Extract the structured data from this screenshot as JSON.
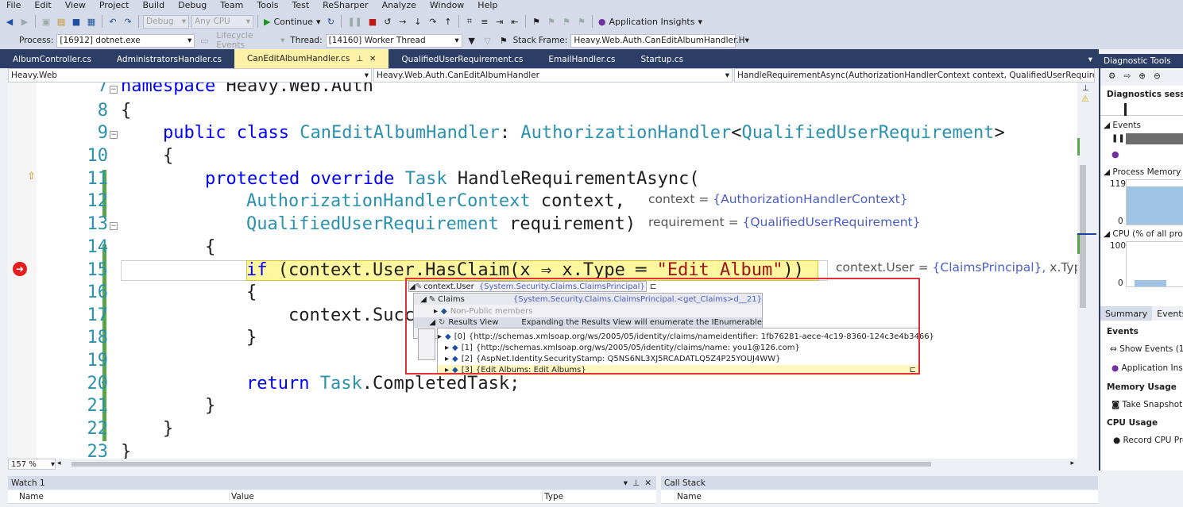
{
  "menu": [
    "File",
    "Edit",
    "View",
    "Project",
    "Build",
    "Debug",
    "Team",
    "Tools",
    "Test",
    "ReSharper",
    "Analyze",
    "Window",
    "Help"
  ],
  "toolbar": {
    "config": "Debug",
    "platform": "Any CPU",
    "continue_label": "Continue",
    "app_insights_label": "Application Insights",
    "process_label": "Process:",
    "process_value": "[16912] dotnet.exe",
    "lifecycle_label": "Lifecycle Events",
    "thread_label": "Thread:",
    "thread_value": "[14160] Worker Thread",
    "stack_frame_label": "Stack Frame:",
    "stack_frame_value": "Heavy.Web.Auth.CanEditAlbumHandler.H"
  },
  "tabs": [
    {
      "label": "AlbumController.cs"
    },
    {
      "label": "AdministratorsHandler.cs"
    },
    {
      "label": "CanEditAlbumHandler.cs"
    },
    {
      "label": "QualifiedUserRequirement.cs"
    },
    {
      "label": "EmailHandler.cs"
    },
    {
      "label": "Startup.cs"
    }
  ],
  "navbar": {
    "project": "Heavy.Web",
    "class": "Heavy.Web.Auth.CanEditAlbumHandler",
    "member": "HandleRequirementAsync(AuthorizationHandlerContext context, QualifiedUserRequirement"
  },
  "code": {
    "line_numbers": [
      "7",
      "8",
      "9",
      "10",
      "11",
      "12",
      "13",
      "14",
      "15",
      "16",
      "17",
      "18",
      "19",
      "20",
      "21",
      "22",
      "23"
    ],
    "l7_kw": "namespace",
    "l7_rest": " Heavy.Web.Auth",
    "l8": "{",
    "l9_kw1": "public",
    "l9_kw2": "class",
    "l9_name": "CanEditAlbumHandler",
    "l9_colon": ": ",
    "l9_base": "AuthorizationHandler",
    "l9_lt": "<",
    "l9_arg": "QualifiedUserRequirement",
    "l9_gt": ">",
    "l10": "{",
    "l11_kw1": "protected",
    "l11_kw2": "override",
    "l11_type": "Task",
    "l11_rest": " HandleRequirementAsync(",
    "l12_type": "AuthorizationHandlerContext",
    "l12_rest": " context,",
    "l13_type": "QualifiedUserRequirement",
    "l13_rest": " requirement)",
    "l14": "{",
    "l15_kw": "if",
    "l15_rest": " (context.User.HasClaim(x ⇒ x.Type ═ ",
    "l15_str": "\"Edit Album\"",
    "l15_end": "))",
    "l16": "{",
    "l17": "context.Succ",
    "l18": "}",
    "l20_kw": "return",
    "l20_type": "Task",
    "l20_rest": ".CompletedTask;",
    "l21": "}",
    "l22": "}",
    "l23": "}"
  },
  "hints": {
    "context_name": "context = ",
    "context_val": "{AuthorizationHandlerContext}",
    "requirement_name": "requirement = ",
    "requirement_val": "{QualifiedUserRequirement}",
    "user_name": "context.User = ",
    "user_val": "{ClaimsPrincipal},",
    "xtype_name": "x.Type ="
  },
  "datatip": {
    "root_name": "context.User",
    "root_val": "{System.Security.Claims.ClaimsPrincipal}",
    "claims_name": "Claims",
    "claims_val": "{System.Security.Claims.ClaimsPrincipal.<get_Claims>d__21}",
    "nonpublic": "Non-Public members",
    "results_name": "Results View",
    "results_val": "Expanding the Results View will enumerate the IEnumerable",
    "items": [
      {
        "idx": "[0]",
        "val": "{http://schemas.xmlsoap.org/ws/2005/05/identity/claims/nameidentifier: 1fb76281-aece-4c19-8360-124c3e4b3466}"
      },
      {
        "idx": "[1]",
        "val": "{http://schemas.xmlsoap.org/ws/2005/05/identity/claims/name: you1@126.com}"
      },
      {
        "idx": "[2]",
        "val": "{AspNet.Identity.SecurityStamp: Q5NS6NL3XJ5RCADATLQ5Z4P25YOUJ4WW}"
      },
      {
        "idx": "[3]",
        "val": "{Edit Albums: Edit Albums}"
      }
    ]
  },
  "zoom": "157 %",
  "watch": {
    "title": "Watch 1",
    "col_name": "Name",
    "col_value": "Value",
    "col_type": "Type"
  },
  "callstack": {
    "title": "Call Stack",
    "col_name": "Name"
  },
  "diag": {
    "title": "Diagnostic Tools",
    "session": "Diagnostics session:",
    "events": "Events",
    "process_memory": "Process Memory (M",
    "mem_max": "119",
    "mem_min": "0",
    "cpu": "CPU (% of all proce",
    "cpu_max": "100",
    "cpu_min": "0",
    "tab_summary": "Summary",
    "tab_events": "Events",
    "sec_events": "Events",
    "show_events": "Show Events (1",
    "app_insights": "Application Insi",
    "sec_memory": "Memory Usage",
    "take_snapshot": "Take Snapshot",
    "sec_cpu": "CPU Usage",
    "record_cpu": "Record CPU Pro"
  },
  "colors": {
    "tab_bar": "#2d3e66",
    "active_tab": "#fff1a8",
    "highlight": "#fff6a0",
    "datatip_border": "#e0303a",
    "keyword": "#0000ff",
    "type": "#2b91af"
  }
}
